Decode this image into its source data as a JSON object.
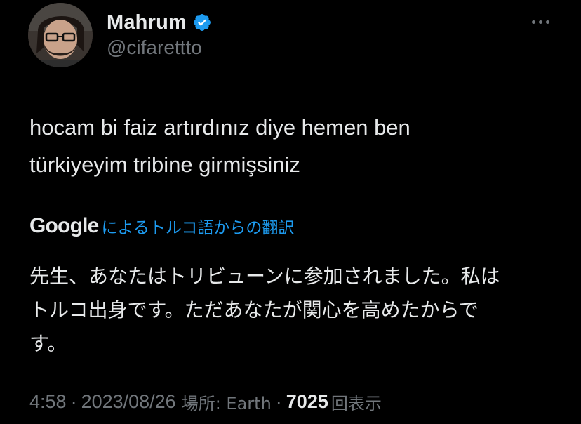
{
  "author": {
    "display_name": "Mahrum",
    "handle": "@cifarettto",
    "verified": true,
    "verified_color": "#1d9bf0",
    "avatar_icon": "profile-photo"
  },
  "header": {
    "more_icon": "more-horizontal-icon"
  },
  "tweet": {
    "text_lines": [
      "hocam bi faiz artırdınız diye hemen ben",
      "türkiyeyim tribine girmişsiniz"
    ]
  },
  "translation": {
    "provider": "Google",
    "label": "によるトルコ語からの翻訳",
    "link_color": "#1d9bf0",
    "text_lines": [
      "先生、あなたはトリビューンに参加されました。私は",
      "トルコ出身です。ただあなたが関心を高めたからで",
      "す。"
    ]
  },
  "meta": {
    "time": "4:58",
    "separator": "·",
    "date": "2023/08/26",
    "location": "場所: Earth",
    "views_count": "7025",
    "views_label": "回表示"
  },
  "colors": {
    "background": "#000000",
    "text": "#e7e9ea",
    "secondary": "#71767b"
  }
}
